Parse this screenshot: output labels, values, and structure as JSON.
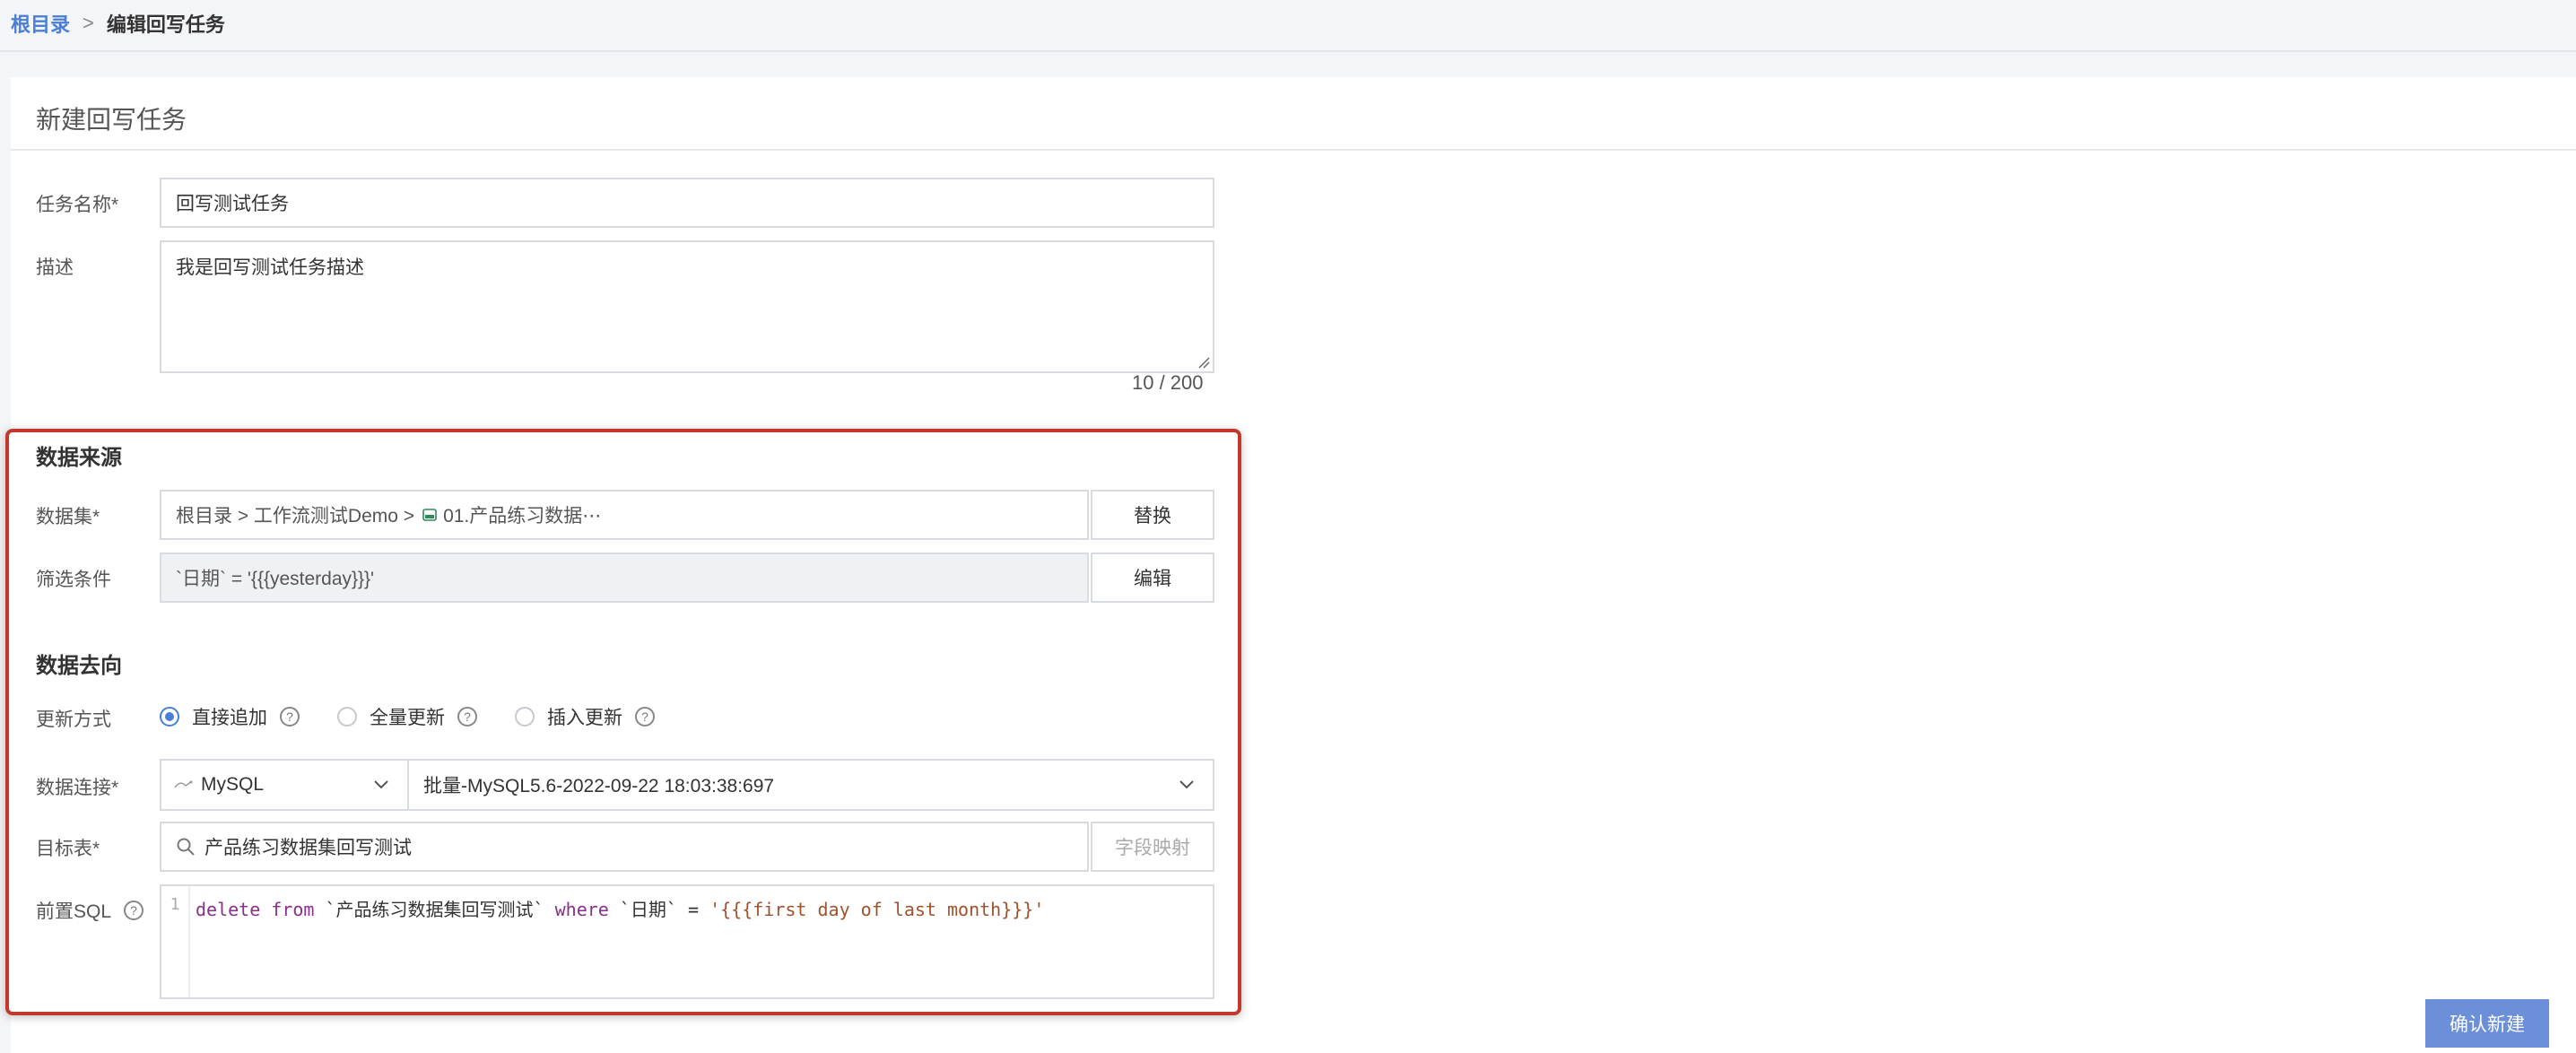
{
  "breadcrumb": {
    "root": "根目录",
    "separator": ">",
    "current": "编辑回写任务"
  },
  "card": {
    "title": "新建回写任务"
  },
  "form": {
    "name_label": "任务名称*",
    "name_value": "回写测试任务",
    "desc_label": "描述",
    "desc_value": "我是回写测试任务描述",
    "desc_counter": "10 / 200"
  },
  "source": {
    "section_title": "数据来源",
    "dataset_label": "数据集*",
    "dataset_path_prefix": "根目录 > 工作流测试Demo >",
    "dataset_name": "01.产品练习数据⋯",
    "replace_button": "替换",
    "filter_label": "筛选条件",
    "filter_value": "`日期` = '{{{yesterday}}}'",
    "edit_button": "编辑"
  },
  "target": {
    "section_title": "数据去向",
    "update_label": "更新方式",
    "update_options": [
      {
        "label": "直接追加",
        "checked": true
      },
      {
        "label": "全量更新",
        "checked": false
      },
      {
        "label": "插入更新",
        "checked": false
      }
    ],
    "connection_label": "数据连接*",
    "connection_type": "MySQL",
    "connection_name": "批量-MySQL5.6-2022-09-22 18:03:38:697",
    "table_label": "目标表*",
    "table_value": "产品练习数据集回写测试",
    "field_mapping_button": "字段映射",
    "presql_label": "前置SQL",
    "presql_line_number": "1",
    "presql_tokens": {
      "kw1": "delete from",
      "ident1": " `产品练习数据集回写测试` ",
      "kw2": "where",
      "ident2": " `日期` = ",
      "str": "'{{{first day of last month}}}'"
    }
  },
  "confirm_button": "确认新建",
  "colors": {
    "accent": "#4a7fd6",
    "primary_button": "#6b8fd9",
    "highlight_border": "#c0392b"
  }
}
